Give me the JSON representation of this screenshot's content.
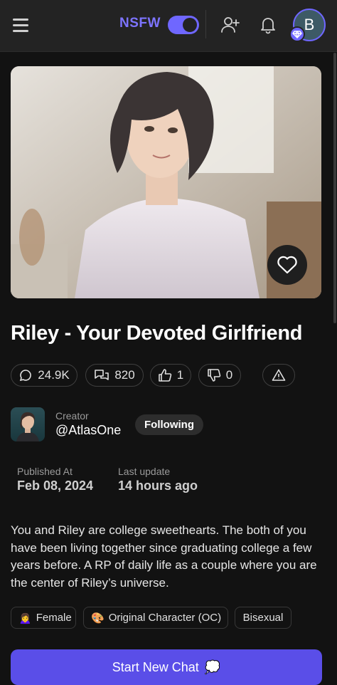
{
  "header": {
    "nsfw_label": "NSFW",
    "nsfw_enabled": true,
    "user_initial": "B",
    "accent_color": "#6f67ff"
  },
  "character": {
    "name": "Riley - Your Devoted Girlfriend",
    "image_alt": "Riley character portrait",
    "favorited": false
  },
  "stats": {
    "chats": "24.9K",
    "messages": "820",
    "likes": "1",
    "dislikes": "0"
  },
  "creator": {
    "label": "Creator",
    "name": "@AtlasOne",
    "follow_label": "Following"
  },
  "meta": {
    "published_label": "Published At",
    "published_value": "Feb 08, 2024",
    "updated_label": "Last update",
    "updated_value": "14 hours ago"
  },
  "description": "You and Riley are college sweethearts. The both of you have been living together since graduating college a few years before. A RP of daily life as a couple where you are the center of Riley’s universe.",
  "tags": [
    {
      "emoji": "🙍‍♀️",
      "label": "Female"
    },
    {
      "emoji": "🎨",
      "label": "Original Character (OC)"
    },
    {
      "emoji": "",
      "label": "Bisexual"
    }
  ],
  "cta": {
    "label": "Start New Chat",
    "emoji": "💭",
    "color": "#5a4ee8"
  }
}
